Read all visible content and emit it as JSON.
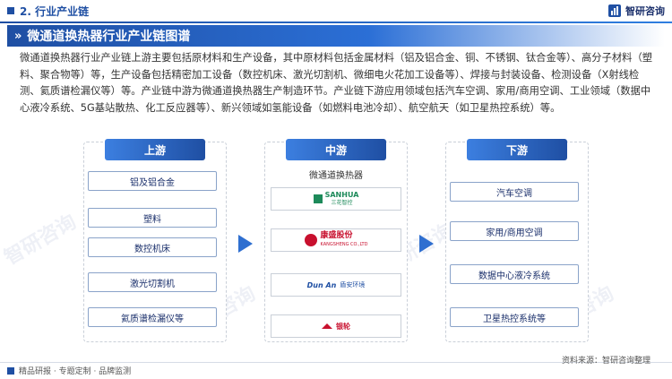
{
  "header": {
    "section": "2. 行业产业链",
    "brand": "智研咨询"
  },
  "title": "微通道换热器行业产业链图谱",
  "description": "微通道换热器行业产业链上游主要包括原材料和生产设备，其中原材料包括金属材料（铝及铝合金、铜、不锈钢、钛合金等）、高分子材料（塑料、聚合物等）等，生产设备包括精密加工设备（数控机床、激光切割机、微细电火花加工设备等）、焊接与封装设备、检测设备（X射线检测、氦质谱检漏仪等）等。产业链中游为微通道换热器生产制造环节。产业链下游应用领域包括汽车空调、家用/商用空调、工业领域（数据中心液冷系统、5G基站散热、化工反应器等）、新兴领域如氢能设备（如燃料电池冷却）、航空航天（如卫星热控系统）等。",
  "upstream": {
    "heading": "上游",
    "items": [
      "铝及铝合金",
      "塑料",
      "数控机床",
      "激光切割机",
      "氦质谱检漏仪等"
    ]
  },
  "midstream": {
    "heading": "中游",
    "caption": "微通道换热器",
    "logos": [
      {
        "name": "SANHUA",
        "sub": "三花智控"
      },
      {
        "name": "康盛股份",
        "sub": "KANGSHENG CO.,LTD"
      },
      {
        "name": "Dun An",
        "sub": "盾安环境"
      },
      {
        "name": "银轮",
        "sub": ""
      }
    ]
  },
  "downstream": {
    "heading": "下游",
    "items": [
      "汽车空调",
      "家用/商用空调",
      "数据中心液冷系统",
      "卫星热控系统等"
    ]
  },
  "footer": {
    "left": "精品研报 · 专题定制 · 品牌监测",
    "source": "资料来源：智研咨询整理"
  },
  "colors": {
    "primary": "#1f4fa3",
    "accent": "#2f6fd0"
  }
}
